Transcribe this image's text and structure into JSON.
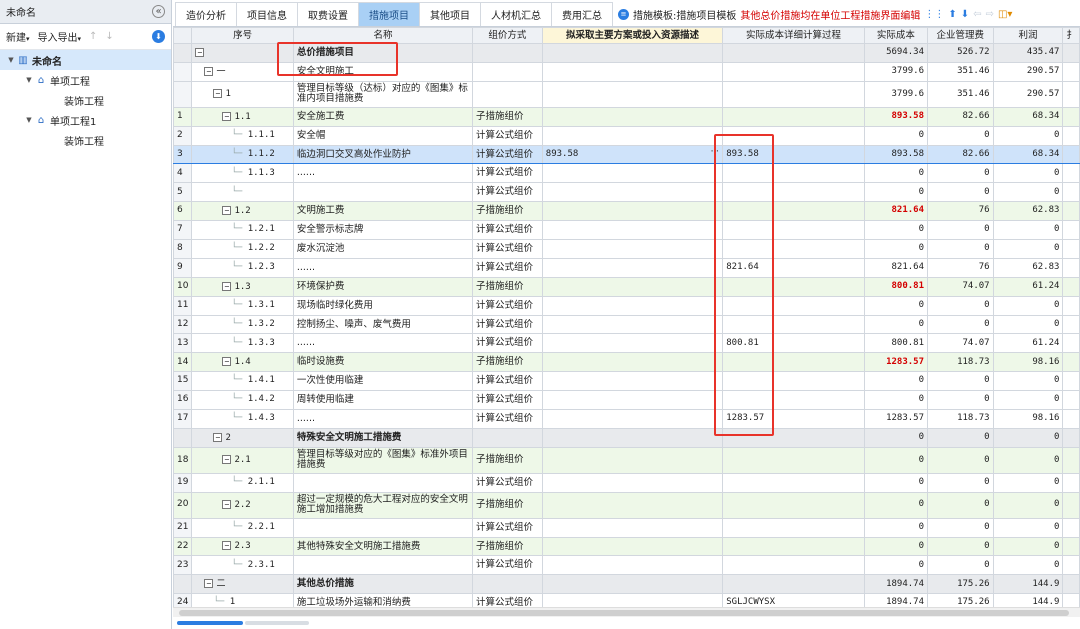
{
  "sidebar": {
    "title": "未命名",
    "toolbar": {
      "new": "新建",
      "import_export": "导入导出"
    },
    "tree": [
      {
        "label": "未命名",
        "level": 0,
        "icon": "building-icon",
        "selected": true,
        "bold": true
      },
      {
        "label": "单项工程",
        "level": 1,
        "icon": "house-icon"
      },
      {
        "label": "装饰工程",
        "level": 2
      },
      {
        "label": "单项工程1",
        "level": 1,
        "icon": "house-icon"
      },
      {
        "label": "装饰工程",
        "level": 2
      }
    ]
  },
  "tabs": [
    {
      "label": "造价分析"
    },
    {
      "label": "项目信息"
    },
    {
      "label": "取费设置"
    },
    {
      "label": "措施项目",
      "active": true
    },
    {
      "label": "其他项目"
    },
    {
      "label": "人材机汇总"
    },
    {
      "label": "费用汇总"
    }
  ],
  "toolbar": {
    "template_label": "措施模板:措施项目模板",
    "notice": "其他总价措施均在单位工程措施界面编辑"
  },
  "columns": [
    "序号",
    "名称",
    "组价方式",
    "拟采取主要方案或投入资源描述",
    "实际成本详细计算过程",
    "实际成本",
    "企业管理费",
    "利润",
    "扌"
  ],
  "rows": [
    {
      "rn": "",
      "seq": "",
      "name": "总价措施项目",
      "method": "",
      "desc": "",
      "proc": "",
      "cost": "5694.34",
      "mgmt": "526.72",
      "profit": "435.47",
      "type": "grp",
      "depth": 0
    },
    {
      "rn": "",
      "seq": "一",
      "name": "安全文明施工",
      "method": "",
      "desc": "",
      "proc": "",
      "cost": "3799.6",
      "mgmt": "351.46",
      "profit": "290.57",
      "type": "plain",
      "depth": 1
    },
    {
      "rn": "",
      "seq": "1",
      "name": "管理目标等级（达标）对应的《图集》标准内项目措施费",
      "method": "",
      "desc": "",
      "proc": "",
      "cost": "3799.6",
      "mgmt": "351.46",
      "profit": "290.57",
      "type": "plain",
      "depth": 2,
      "tall": true
    },
    {
      "rn": "1",
      "seq": "1.1",
      "name": "安全施工费",
      "method": "子措施组价",
      "desc": "",
      "proc": "",
      "cost": "893.58",
      "mgmt": "82.66",
      "profit": "68.34",
      "type": "sub",
      "depth": 3,
      "red": true
    },
    {
      "rn": "2",
      "seq": "1.1.1",
      "name": "安全帽",
      "method": "计算公式组价",
      "desc": "",
      "proc": "",
      "cost": "0",
      "mgmt": "0",
      "profit": "0",
      "type": "leaf",
      "depth": 4
    },
    {
      "rn": "3",
      "seq": "1.1.2",
      "name": "临边洞口交叉高处作业防护",
      "method": "计算公式组价",
      "desc": "893.58",
      "proc": "893.58",
      "cost": "893.58",
      "mgmt": "82.66",
      "profit": "68.34",
      "type": "cur",
      "depth": 4
    },
    {
      "rn": "4",
      "seq": "1.1.3",
      "name": "......",
      "method": "计算公式组价",
      "desc": "",
      "proc": "",
      "cost": "0",
      "mgmt": "0",
      "profit": "0",
      "type": "leaf",
      "depth": 4
    },
    {
      "rn": "5",
      "seq": "",
      "name": "",
      "method": "计算公式组价",
      "desc": "",
      "proc": "",
      "cost": "0",
      "mgmt": "0",
      "profit": "0",
      "type": "leaf",
      "depth": 4
    },
    {
      "rn": "6",
      "seq": "1.2",
      "name": "文明施工费",
      "method": "子措施组价",
      "desc": "",
      "proc": "",
      "cost": "821.64",
      "mgmt": "76",
      "profit": "62.83",
      "type": "sub",
      "depth": 3,
      "red": true
    },
    {
      "rn": "7",
      "seq": "1.2.1",
      "name": "安全警示标志牌",
      "method": "计算公式组价",
      "desc": "",
      "proc": "",
      "cost": "0",
      "mgmt": "0",
      "profit": "0",
      "type": "leaf",
      "depth": 4
    },
    {
      "rn": "8",
      "seq": "1.2.2",
      "name": "废水沉淀池",
      "method": "计算公式组价",
      "desc": "",
      "proc": "",
      "cost": "0",
      "mgmt": "0",
      "profit": "0",
      "type": "leaf",
      "depth": 4
    },
    {
      "rn": "9",
      "seq": "1.2.3",
      "name": "......",
      "method": "计算公式组价",
      "desc": "",
      "proc": "821.64",
      "cost": "821.64",
      "mgmt": "76",
      "profit": "62.83",
      "type": "leaf",
      "depth": 4
    },
    {
      "rn": "10",
      "seq": "1.3",
      "name": "环境保护费",
      "method": "子措施组价",
      "desc": "",
      "proc": "",
      "cost": "800.81",
      "mgmt": "74.07",
      "profit": "61.24",
      "type": "sub",
      "depth": 3,
      "red": true
    },
    {
      "rn": "11",
      "seq": "1.3.1",
      "name": "现场临时绿化费用",
      "method": "计算公式组价",
      "desc": "",
      "proc": "",
      "cost": "0",
      "mgmt": "0",
      "profit": "0",
      "type": "leaf",
      "depth": 4
    },
    {
      "rn": "12",
      "seq": "1.3.2",
      "name": "控制扬尘、噪声、废气费用",
      "method": "计算公式组价",
      "desc": "",
      "proc": "",
      "cost": "0",
      "mgmt": "0",
      "profit": "0",
      "type": "leaf",
      "depth": 4
    },
    {
      "rn": "13",
      "seq": "1.3.3",
      "name": "......",
      "method": "计算公式组价",
      "desc": "",
      "proc": "800.81",
      "cost": "800.81",
      "mgmt": "74.07",
      "profit": "61.24",
      "type": "leaf",
      "depth": 4
    },
    {
      "rn": "14",
      "seq": "1.4",
      "name": "临时设施费",
      "method": "子措施组价",
      "desc": "",
      "proc": "",
      "cost": "1283.57",
      "mgmt": "118.73",
      "profit": "98.16",
      "type": "sub",
      "depth": 3,
      "red": true
    },
    {
      "rn": "15",
      "seq": "1.4.1",
      "name": "一次性使用临建",
      "method": "计算公式组价",
      "desc": "",
      "proc": "",
      "cost": "0",
      "mgmt": "0",
      "profit": "0",
      "type": "leaf",
      "depth": 4
    },
    {
      "rn": "16",
      "seq": "1.4.2",
      "name": "周转使用临建",
      "method": "计算公式组价",
      "desc": "",
      "proc": "",
      "cost": "0",
      "mgmt": "0",
      "profit": "0",
      "type": "leaf",
      "depth": 4
    },
    {
      "rn": "17",
      "seq": "1.4.3",
      "name": "......",
      "method": "计算公式组价",
      "desc": "",
      "proc": "1283.57",
      "cost": "1283.57",
      "mgmt": "118.73",
      "profit": "98.16",
      "type": "leaf",
      "depth": 4
    },
    {
      "rn": "",
      "seq": "2",
      "name": "特殊安全文明施工措施费",
      "method": "",
      "desc": "",
      "proc": "",
      "cost": "0",
      "mgmt": "0",
      "profit": "0",
      "type": "grp2",
      "depth": 2
    },
    {
      "rn": "18",
      "seq": "2.1",
      "name": "管理目标等级对应的《图集》标准外项目措施费",
      "method": "子措施组价",
      "desc": "",
      "proc": "",
      "cost": "0",
      "mgmt": "0",
      "profit": "0",
      "type": "sub",
      "depth": 3,
      "tall": true
    },
    {
      "rn": "19",
      "seq": "2.1.1",
      "name": "",
      "method": "计算公式组价",
      "desc": "",
      "proc": "",
      "cost": "0",
      "mgmt": "0",
      "profit": "0",
      "type": "leaf",
      "depth": 4
    },
    {
      "rn": "20",
      "seq": "2.2",
      "name": "超过一定规模的危大工程对应的安全文明施工增加措施费",
      "method": "子措施组价",
      "desc": "",
      "proc": "",
      "cost": "0",
      "mgmt": "0",
      "profit": "0",
      "type": "sub",
      "depth": 3,
      "tall": true
    },
    {
      "rn": "21",
      "seq": "2.2.1",
      "name": "",
      "method": "计算公式组价",
      "desc": "",
      "proc": "",
      "cost": "0",
      "mgmt": "0",
      "profit": "0",
      "type": "leaf",
      "depth": 4
    },
    {
      "rn": "22",
      "seq": "2.3",
      "name": "其他特殊安全文明施工措施费",
      "method": "子措施组价",
      "desc": "",
      "proc": "",
      "cost": "0",
      "mgmt": "0",
      "profit": "0",
      "type": "sub",
      "depth": 3
    },
    {
      "rn": "23",
      "seq": "2.3.1",
      "name": "",
      "method": "计算公式组价",
      "desc": "",
      "proc": "",
      "cost": "0",
      "mgmt": "0",
      "profit": "0",
      "type": "leaf",
      "depth": 4
    },
    {
      "rn": "",
      "seq": "二",
      "name": "其他总价措施",
      "method": "",
      "desc": "",
      "proc": "",
      "cost": "1894.74",
      "mgmt": "175.26",
      "profit": "144.9",
      "type": "grp2",
      "depth": 1
    },
    {
      "rn": "24",
      "seq": "1",
      "name": "施工垃圾场外运输和消纳费",
      "method": "计算公式组价",
      "desc": "",
      "proc": "SGLJCWYSX",
      "cost": "1894.74",
      "mgmt": "175.26",
      "profit": "144.9",
      "type": "leaf",
      "depth": 2
    }
  ]
}
